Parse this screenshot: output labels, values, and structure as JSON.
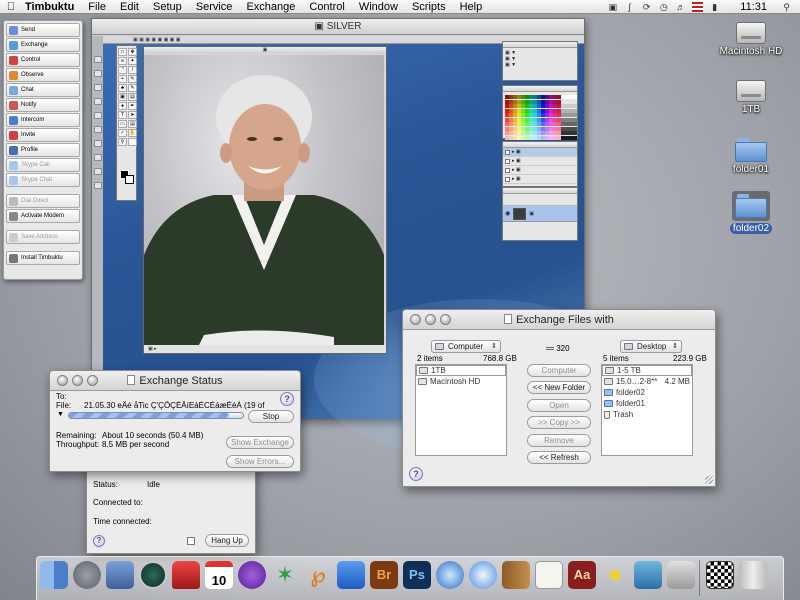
{
  "menubar": {
    "app": "Timbuktu",
    "menus": [
      "File",
      "Edit",
      "Setup",
      "Service",
      "Exchange",
      "Control",
      "Window",
      "Scripts",
      "Help"
    ],
    "clock": "11:31"
  },
  "palette": {
    "items": [
      "Send",
      "Exchange",
      "Control",
      "Observe",
      "Chat",
      "Notify",
      "Intercom",
      "Invite",
      "Profile",
      "Skype Call",
      "Skype Chat",
      "Dial Direct",
      "Activate Modem",
      "Save Address",
      "Install Timbuktu"
    ]
  },
  "photoshop": {
    "window_title": "SILVER"
  },
  "desktop": {
    "icons": [
      "Macintosh HD",
      "1TB",
      "folder01",
      "folder02"
    ]
  },
  "exchange_files": {
    "title": "Exchange Files with",
    "left_popup": "Computer",
    "left_count": "2 items",
    "left_size": "768.8 GB",
    "mid_count": "320",
    "right_popup": "Desktop",
    "right_count": "5 items",
    "right_size": "223.9 GB",
    "left_items": [
      "1TB",
      "Macintosh HD"
    ],
    "right_items": [
      "1-5 TB",
      "15.0…2-8**",
      "folder02",
      "folder01",
      "Trash"
    ],
    "right_item_size": "4.2 MB",
    "buttons": [
      "Computer",
      "<< New Folder",
      "Open",
      ">> Copy >>",
      "Remove",
      "<< Refresh"
    ]
  },
  "exchange_status": {
    "title": "Exchange Status",
    "to_label": "To:",
    "file_label": "File:",
    "file_value": "21.05.30 eÄé åTic Ç'ÇÕÇÉÄíEáÉCÉáæÈéÁ (19 of",
    "stop": "Stop",
    "remaining_label": "Remaining:",
    "remaining_value": "About 10 seconds (50.4 MB)",
    "throughput_label": "Throughput:",
    "throughput_value": "8.5 MB per second",
    "show_exchange": "Show Exchange",
    "show_errors": "Show Errors...",
    "progress": 0.92
  },
  "session": {
    "status_label": "Status:",
    "status_value": "Idle",
    "connected_to_label": "Connected to:",
    "time_connected_label": "Time connected:",
    "hang_up": "Hang Up"
  },
  "dock": {
    "icons": [
      "finder-icon",
      "system-preferences-icon",
      "expose-icon",
      "time-machine-icon",
      "timbuktu-icon",
      "ical-icon",
      "emacs-icon",
      "xcode-icon",
      "pages-icon",
      "word-icon",
      "bridge-icon",
      "photoshop-icon",
      "quicktime-icon",
      "safari-icon",
      "address-book-icon",
      "textedit-icon",
      "dictionary-icon",
      "cyberduck-icon",
      "home-icon",
      "image-capture-icon",
      "checkerboard-icon",
      "trash-icon"
    ],
    "labels": {
      "bridge": "Br",
      "photoshop": "Ps",
      "dictionary": "Aa",
      "ical_day": "10"
    }
  }
}
